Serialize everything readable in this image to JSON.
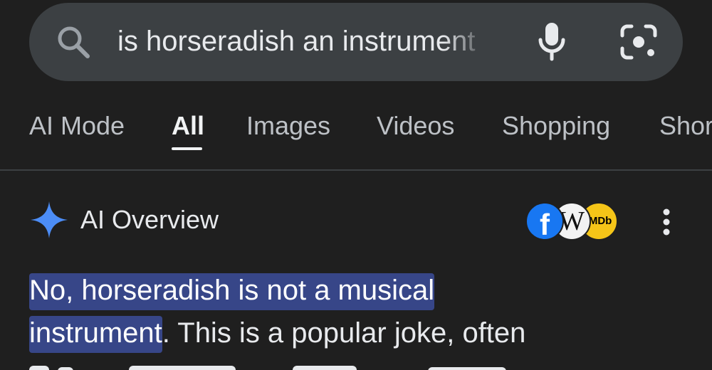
{
  "search": {
    "query": "is horseradish an instrument",
    "icons": [
      "search-icon",
      "microphone-icon",
      "google-lens-icon"
    ]
  },
  "tabs": [
    {
      "label": "AI Mode",
      "active": false
    },
    {
      "label": "All",
      "active": true
    },
    {
      "label": "Images",
      "active": false
    },
    {
      "label": "Videos",
      "active": false
    },
    {
      "label": "Shopping",
      "active": false
    },
    {
      "label": "Shor",
      "active": false
    }
  ],
  "ai_overview": {
    "title": "AI Overview",
    "sources": {
      "facebook": "f",
      "wikipedia": "W",
      "imdb": "IMDb"
    },
    "answer": {
      "highlight_line1": "No, horseradish is not a musical",
      "highlight_line2": "instrument",
      "rest": ". This is a popular joke, often"
    }
  },
  "colors": {
    "background": "#1f1f1f",
    "search_bar": "#3c4043",
    "highlight": "#374688",
    "spark_blue": "#4c8df6"
  }
}
